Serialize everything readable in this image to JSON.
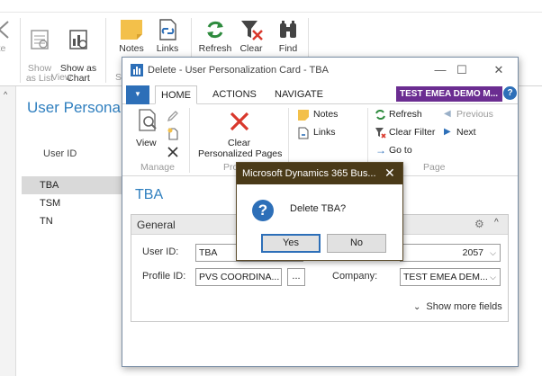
{
  "background": {
    "ribbon": {
      "buttons": [
        {
          "label": "te",
          "icon": "arrow-icon",
          "dim": true
        },
        {
          "label": "Show\nas List",
          "icon": "list-icon",
          "dim": true
        },
        {
          "label": "Show as\nChart",
          "icon": "chart-icon",
          "dim": false
        },
        {
          "label": "Notes",
          "icon": "notes-icon",
          "dim": false
        },
        {
          "label": "Links",
          "icon": "links-icon",
          "dim": false
        },
        {
          "label": "Refresh",
          "icon": "refresh-icon",
          "dim": false
        },
        {
          "label": "Clear",
          "icon": "clear-filter-icon",
          "dim": false
        },
        {
          "label": "Find",
          "icon": "find-icon",
          "dim": false
        }
      ],
      "groups": {
        "view": "View",
        "show_partial": "S"
      }
    },
    "page_title": "User Personaliz",
    "column_header": "User ID",
    "rows": [
      {
        "user_id": "TBA",
        "selected": true
      },
      {
        "user_id": "TSM",
        "selected": false
      },
      {
        "user_id": "TN",
        "selected": false
      }
    ]
  },
  "card": {
    "title": "Delete - User Personalization Card - TBA",
    "window_controls": {
      "minimize": "—",
      "maximize": "☐",
      "close": "✕"
    },
    "tabs": {
      "home": "HOME",
      "actions": "ACTIONS",
      "navigate": "NAVIGATE"
    },
    "company_badge": "TEST EMEA DEMO M...",
    "help": "?",
    "ribbon": {
      "view": "View",
      "clear_pages_line1": "Clear",
      "clear_pages_line2": "Personalized Pages",
      "notes": "Notes",
      "links": "Links",
      "refresh": "Refresh",
      "clear_filter": "Clear Filter",
      "go_to": "Go to",
      "previous": "Previous",
      "next": "Next",
      "groups": {
        "manage": "Manage",
        "process_partial": "Pro",
        "page": "Page"
      }
    },
    "heading": "TBA",
    "general": {
      "title": "General",
      "user_id_label": "User ID:",
      "user_id_value": "TBA",
      "profile_id_label": "Profile ID:",
      "profile_id_value": "PVS COORDINA...",
      "ellipsis": "...",
      "language_value": "2057",
      "company_label": "Company:",
      "company_value": "TEST EMEA DEM...",
      "show_more": "Show more fields"
    }
  },
  "confirm": {
    "title": "Microsoft Dynamics 365 Bus...",
    "message": "Delete TBA?",
    "yes": "Yes",
    "no": "No"
  },
  "colors": {
    "accent_blue": "#2d6fb8",
    "title_blue": "#2f7fbf",
    "company_purple": "#6b2d91",
    "confirm_titlebar": "#4a3a18",
    "delete_red": "#d9382c",
    "refresh_green": "#2e8b3e"
  }
}
